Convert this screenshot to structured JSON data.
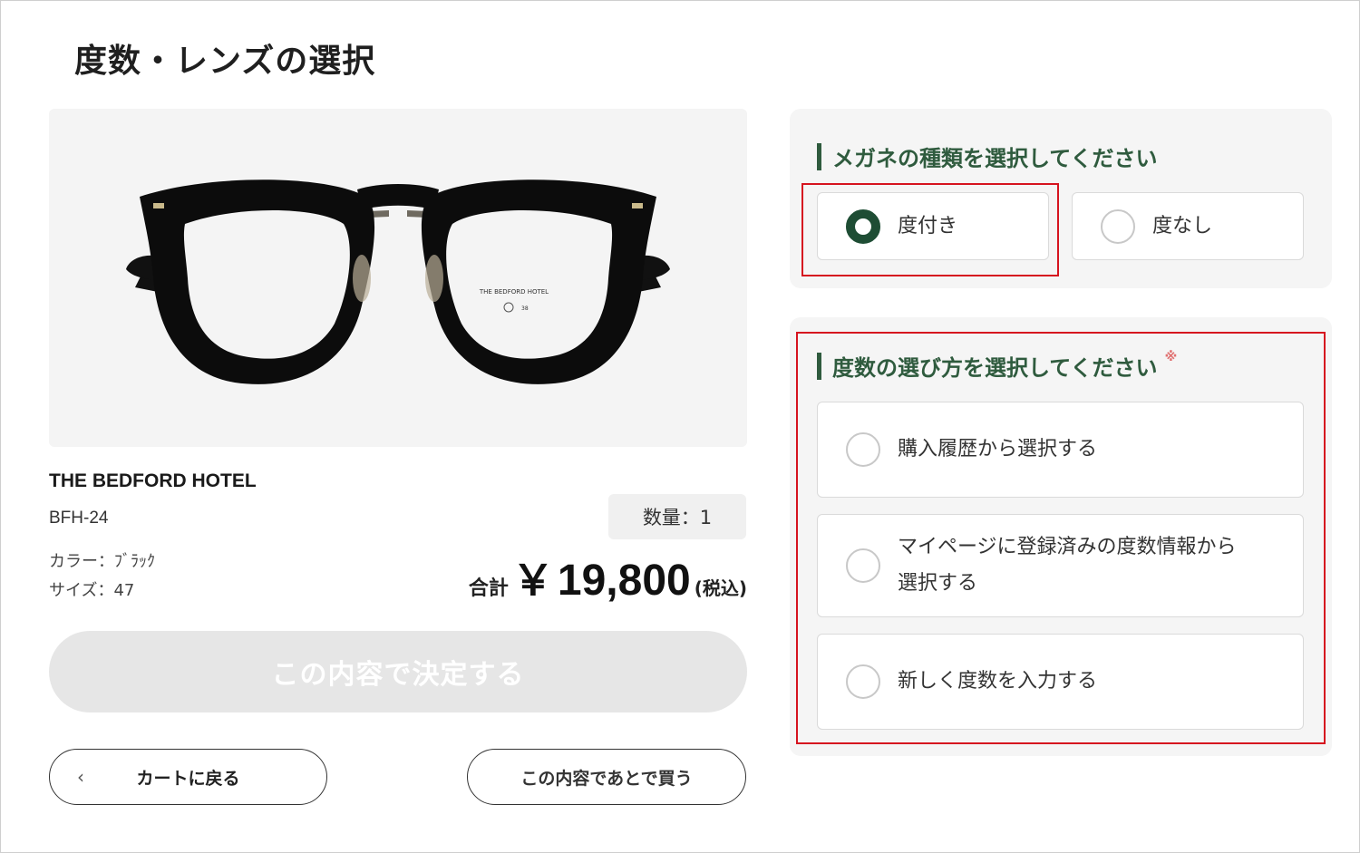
{
  "page_title": "度数・レンズの選択",
  "product": {
    "brand": "THE BEDFORD HOTEL",
    "model": "BFH-24",
    "color": "カラー：ﾌﾞﾗｯｸ",
    "size": "サイズ：47",
    "frame_engraving": "THE BEDFORD HOTEL",
    "frame_mark": "38"
  },
  "quantity": "数量：1",
  "total": {
    "label": "合計",
    "currency": "￥",
    "amount": "19,800",
    "tax_note": "(税込)"
  },
  "buttons": {
    "confirm": "この内容で決定する",
    "back_to_cart": "カートに戻る",
    "back_chevron": "‹",
    "buy_later": "この内容であとで買う"
  },
  "glasses_type": {
    "heading": "メガネの種類を選択してください",
    "options": [
      {
        "label": "度付き",
        "selected": true
      },
      {
        "label": "度なし",
        "selected": false
      }
    ]
  },
  "prescription_method": {
    "heading": "度数の選び方を選択してください",
    "required_mark": "※",
    "options": [
      {
        "label": "購入履歴から選択する",
        "selected": false
      },
      {
        "label_line1": "マイページに登録済みの度数情報から",
        "label_line2": "選択する",
        "selected": false
      },
      {
        "label": "新しく度数を入力する",
        "selected": false
      }
    ]
  },
  "colors": {
    "accent_green": "#2f5b3e",
    "radio_selected": "#1e4d34",
    "highlight_red": "#d6141f",
    "disabled_button": "#e6e6e6"
  }
}
